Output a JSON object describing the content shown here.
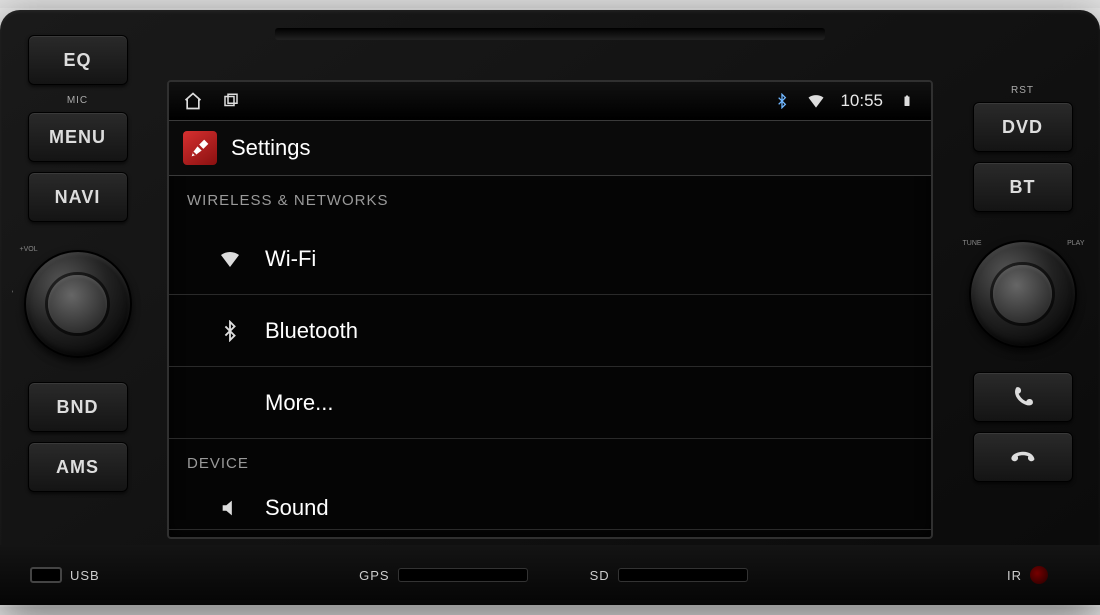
{
  "hardware": {
    "left_buttons": {
      "eq": "EQ",
      "mic": "MIC",
      "menu": "MENU",
      "navi": "NAVI",
      "bnd": "BND",
      "ams": "AMS",
      "vol_plus": "+VOL",
      "vol_minus": "-"
    },
    "right_buttons": {
      "rst": "RST",
      "dvd": "DVD",
      "bt": "BT",
      "tune": "TUNE",
      "play": "PLAY"
    },
    "bottom": {
      "usb": "USB",
      "gps": "GPS",
      "sd": "SD",
      "ir": "IR"
    }
  },
  "status_bar": {
    "time": "10:55"
  },
  "screen": {
    "title": "Settings",
    "sections": [
      {
        "header": "WIRELESS & NETWORKS",
        "items": [
          {
            "label": "Wi-Fi",
            "icon": "wifi-icon"
          },
          {
            "label": "Bluetooth",
            "icon": "bluetooth-icon"
          },
          {
            "label": "More...",
            "icon": ""
          }
        ]
      },
      {
        "header": "DEVICE",
        "items": [
          {
            "label": "Sound",
            "icon": "speaker-icon"
          }
        ]
      }
    ]
  }
}
